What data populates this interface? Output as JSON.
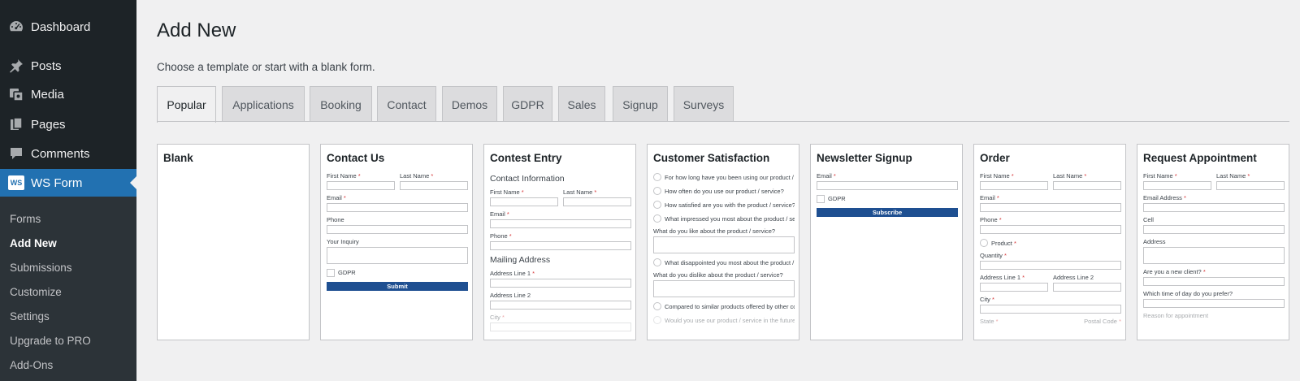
{
  "sidebar": {
    "menu": [
      {
        "label": "Dashboard",
        "icon": "dashboard-icon"
      },
      {
        "label": "Posts",
        "icon": "pin-icon"
      },
      {
        "label": "Media",
        "icon": "media-icon"
      },
      {
        "label": "Pages",
        "icon": "pages-icon"
      },
      {
        "label": "Comments",
        "icon": "comments-icon"
      },
      {
        "label": "WS Form",
        "icon": "ws-form-logo-icon",
        "logo_text": "WS"
      }
    ],
    "submenu": [
      "Forms",
      "Add New",
      "Submissions",
      "Customize",
      "Settings",
      "Upgrade to PRO",
      "Add-Ons"
    ]
  },
  "header": {
    "title": "Add New",
    "description": "Choose a template or start with a blank form."
  },
  "tabs": [
    "Popular",
    "Applications",
    "Booking",
    "Contact",
    "Demos",
    "GDPR",
    "Sales",
    "Signup",
    "Surveys"
  ],
  "colors": {
    "accent": "#2271b1",
    "sidebar": "#1d2327",
    "button": "#1e4f91",
    "required": "#d63638"
  },
  "templates": {
    "blank": {
      "title": "Blank"
    },
    "contact": {
      "title": "Contact Us",
      "first_name": "First Name",
      "last_name": "Last Name",
      "email": "Email",
      "phone": "Phone",
      "inquiry": "Your Inquiry",
      "gdpr": "GDPR",
      "submit": "Submit",
      "req": "*"
    },
    "contest": {
      "title": "Contest Entry",
      "section1": "Contact Information",
      "first_name": "First Name",
      "last_name": "Last Name",
      "email": "Email",
      "phone": "Phone",
      "section2": "Mailing Address",
      "address1": "Address Line 1",
      "address2": "Address Line 2",
      "city": "City",
      "req": "*"
    },
    "satisfaction": {
      "title": "Customer Satisfaction",
      "q1": "For how long have you been using our product / service?",
      "q2": "How often do you use our product / service?",
      "q3": "How satisfied are you with the product / service?",
      "q4": "What impressed you most about the product / service?",
      "q5": "What do you like about the product / service?",
      "q6": "What disappointed you most about the product / service?",
      "q7": "What do you dislike about the product / service?",
      "q8": "Compared to similar products offered by other companies",
      "q9": "Would you use our product / service in the future?"
    },
    "newsletter": {
      "title": "Newsletter Signup",
      "email": "Email",
      "gdpr": "GDPR",
      "subscribe": "Subscribe",
      "req": "*"
    },
    "order": {
      "title": "Order",
      "first_name": "First Name",
      "last_name": "Last Name",
      "email": "Email",
      "phone": "Phone",
      "product": "Product",
      "quantity": "Quantity",
      "address1": "Address Line 1",
      "address2": "Address Line 2",
      "city": "City",
      "state": "State",
      "postal": "Postal Code",
      "req": "*"
    },
    "appointment": {
      "title": "Request Appointment",
      "first_name": "First Name",
      "last_name": "Last Name",
      "email": "Email Address",
      "cell": "Cell",
      "address": "Address",
      "new_client": "Are you a new client?",
      "time_of_day": "Which time of day do you prefer?",
      "reason": "Reason for appointment",
      "req": "*"
    }
  }
}
